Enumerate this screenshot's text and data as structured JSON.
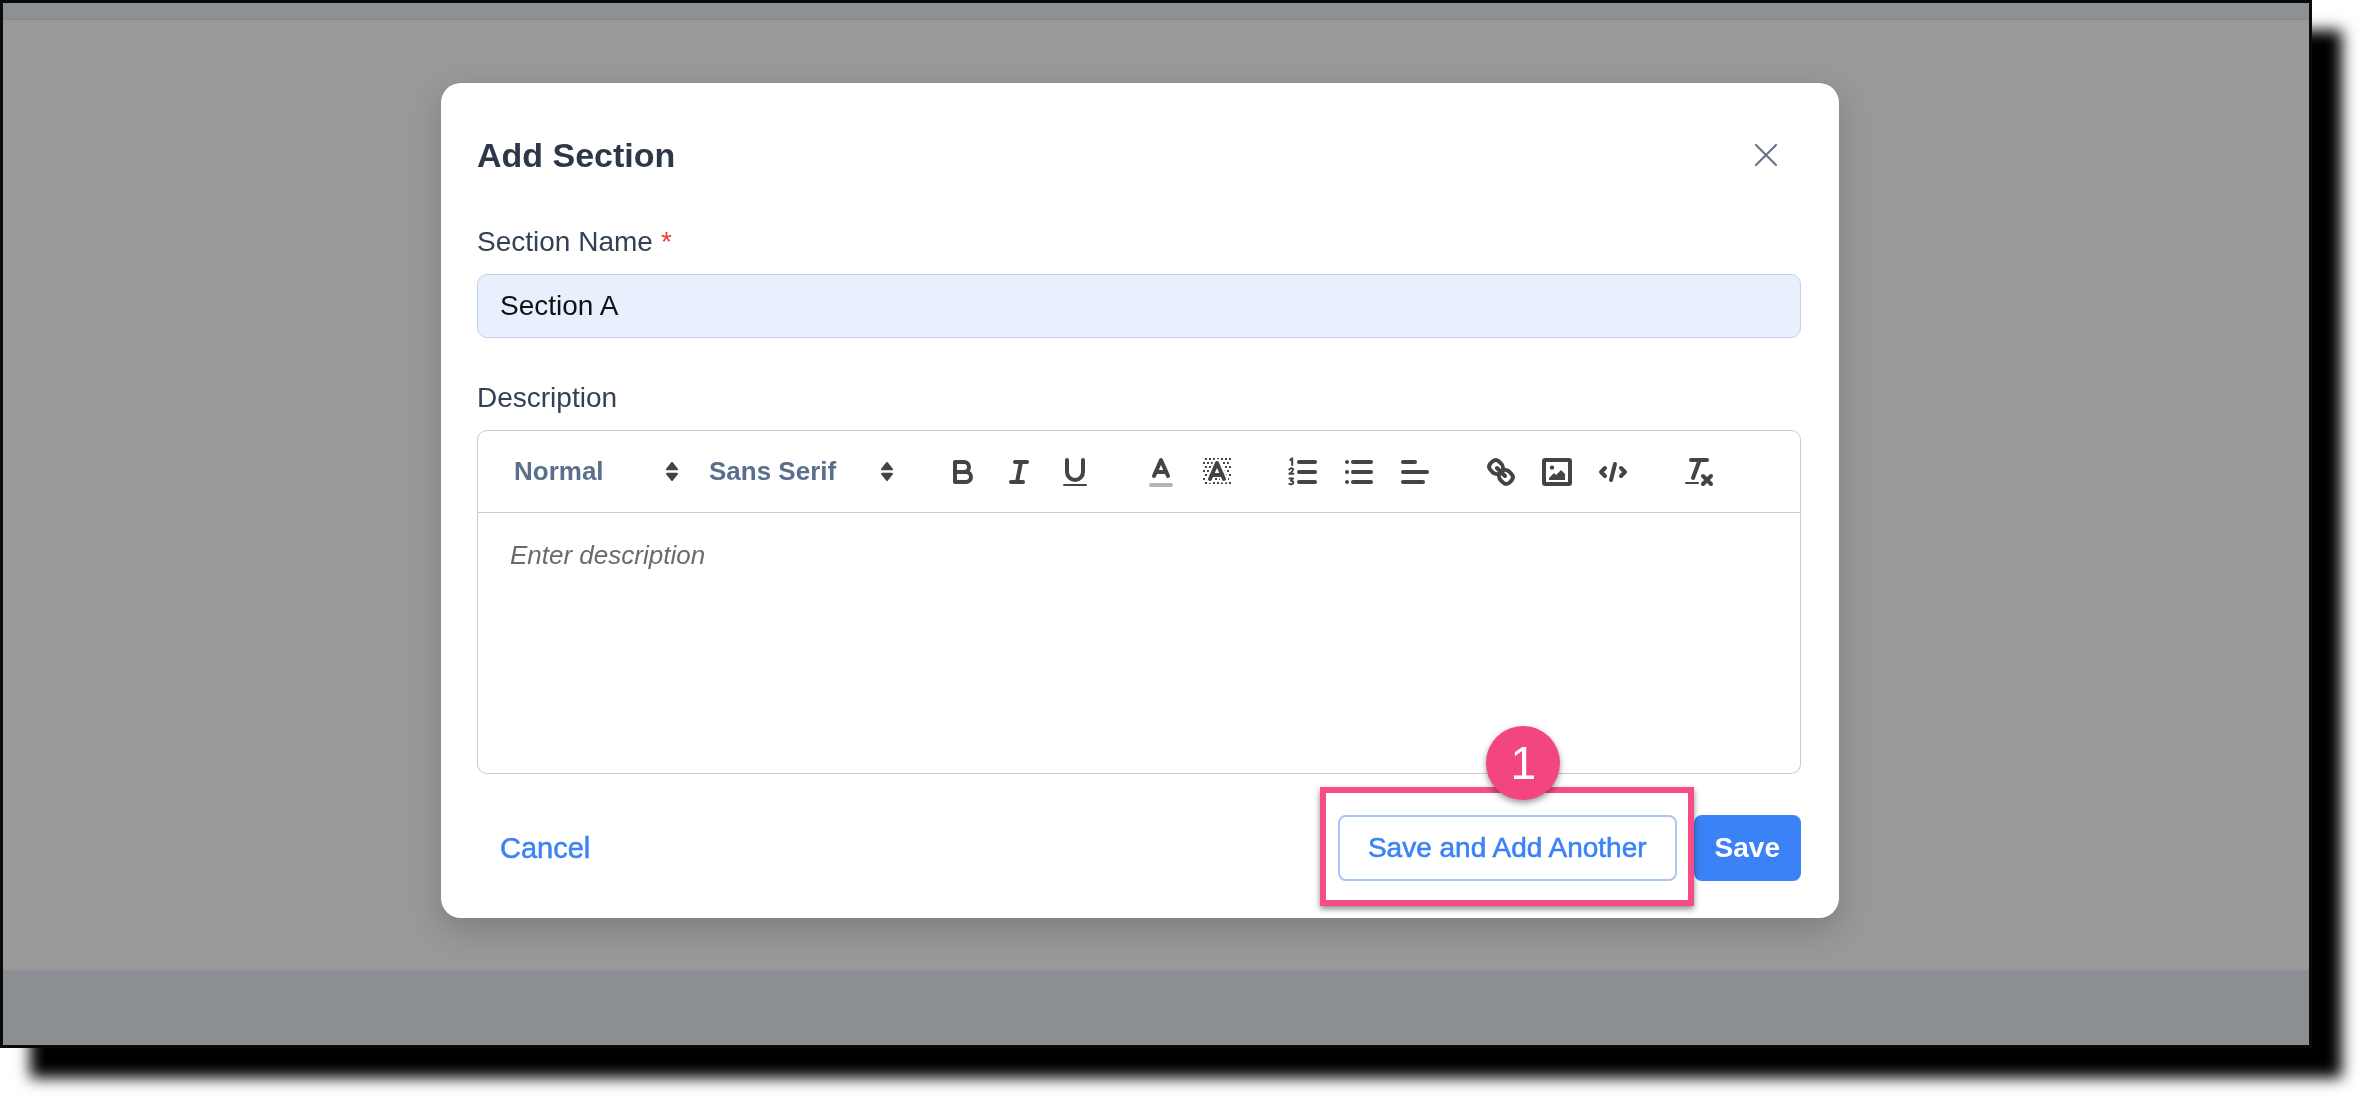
{
  "dialog": {
    "title": "Add Section",
    "fields": [
      {
        "kind": "text",
        "label": "Section Name",
        "required_mark": "*",
        "value": "Section A",
        "autofilled": true
      },
      {
        "kind": "richtext",
        "label": "Description",
        "placeholder": "Enter description",
        "toolbar": {
          "selects": [
            {
              "value": "Normal"
            },
            {
              "value": "Sans Serif"
            }
          ],
          "groups": [
            [
              {
                "kind": "bold"
              },
              {
                "kind": "italic"
              },
              {
                "kind": "underline"
              }
            ],
            [
              {
                "kind": "color"
              },
              {
                "kind": "background"
              }
            ],
            [
              {
                "kind": "ordered"
              },
              {
                "kind": "bullet"
              },
              {
                "kind": "align"
              }
            ],
            [
              {
                "kind": "link"
              },
              {
                "kind": "image"
              },
              {
                "kind": "code"
              }
            ],
            [
              {
                "kind": "clean"
              }
            ]
          ]
        }
      }
    ],
    "actions": [
      {
        "kind": "link",
        "label": "Cancel"
      },
      {
        "kind": "secondary",
        "label": "Save and Add Another",
        "callout": "1"
      },
      {
        "kind": "primary",
        "label": "Save"
      }
    ]
  }
}
